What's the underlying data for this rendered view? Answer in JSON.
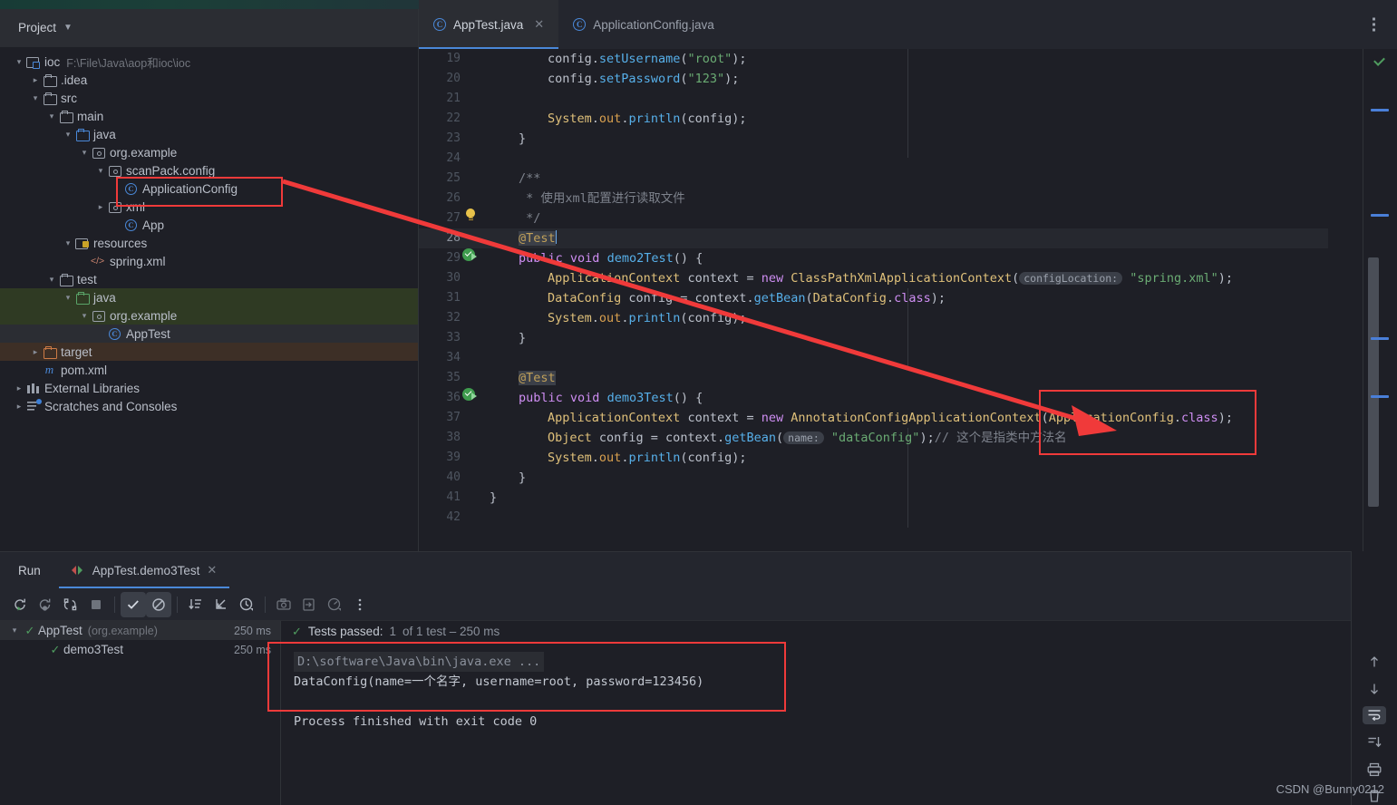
{
  "project_panel": {
    "title": "Project",
    "tree": [
      {
        "indent": 0,
        "arrow": "v",
        "icon": "module-icon",
        "label": "ioc",
        "sub": "F:\\File\\Java\\aop和ioc\\ioc"
      },
      {
        "indent": 1,
        "arrow": ">",
        "icon": "folder-icon",
        "label": ".idea",
        "sub": ""
      },
      {
        "indent": 1,
        "arrow": "v",
        "icon": "folder-icon",
        "label": "src",
        "sub": ""
      },
      {
        "indent": 2,
        "arrow": "v",
        "icon": "folder-icon",
        "label": "main",
        "sub": ""
      },
      {
        "indent": 3,
        "arrow": "v",
        "icon": "source-folder-icon",
        "label": "java",
        "sub": ""
      },
      {
        "indent": 4,
        "arrow": "v",
        "icon": "package-icon",
        "label": "org.example",
        "sub": ""
      },
      {
        "indent": 5,
        "arrow": "v",
        "icon": "package-icon",
        "label": "scanPack.config",
        "sub": ""
      },
      {
        "indent": 6,
        "arrow": "",
        "icon": "class-icon",
        "label": "ApplicationConfig",
        "sub": ""
      },
      {
        "indent": 5,
        "arrow": ">",
        "icon": "package-icon",
        "label": "xml",
        "sub": ""
      },
      {
        "indent": 6,
        "arrow": "",
        "icon": "class-icon",
        "label": "App",
        "sub": ""
      },
      {
        "indent": 3,
        "arrow": "v",
        "icon": "resources-folder-icon",
        "label": "resources",
        "sub": ""
      },
      {
        "indent": 4,
        "arrow": "",
        "icon": "xml-file-icon",
        "label": "spring.xml",
        "sub": ""
      },
      {
        "indent": 2,
        "arrow": "v",
        "icon": "folder-icon",
        "label": "test",
        "sub": ""
      },
      {
        "indent": 3,
        "arrow": "v",
        "icon": "test-source-folder-icon",
        "label": "java",
        "sub": ""
      },
      {
        "indent": 4,
        "arrow": "v",
        "icon": "package-icon",
        "label": "org.example",
        "sub": ""
      },
      {
        "indent": 5,
        "arrow": "",
        "icon": "class-icon",
        "label": "AppTest",
        "sub": ""
      },
      {
        "indent": 1,
        "arrow": ">",
        "icon": "excluded-folder-icon",
        "label": "target",
        "sub": ""
      },
      {
        "indent": 1,
        "arrow": "",
        "icon": "maven-file-icon",
        "label": "pom.xml",
        "sub": ""
      },
      {
        "indent": 0,
        "arrow": ">",
        "icon": "library-icon",
        "label": "External Libraries",
        "sub": ""
      },
      {
        "indent": 0,
        "arrow": ">",
        "icon": "scratches-icon",
        "label": "Scratches and Consoles",
        "sub": ""
      }
    ]
  },
  "editor": {
    "tabs": [
      {
        "label": "ApplicationConfig.java",
        "active": false,
        "closable": false
      },
      {
        "label": "AppTest.java",
        "active": true,
        "closable": true
      }
    ],
    "first_line": 19,
    "lines": [
      {
        "n": 19,
        "gutter": "",
        "indent": 2,
        "parts": [
          {
            "t": "config",
            "c": "var"
          },
          {
            "t": ".",
            "c": "pun"
          },
          {
            "t": "setUsername",
            "c": "mth"
          },
          {
            "t": "(",
            "c": "pun"
          },
          {
            "t": "\"root\"",
            "c": "str"
          },
          {
            "t": ");",
            "c": "pun"
          }
        ]
      },
      {
        "n": 20,
        "gutter": "",
        "indent": 2,
        "parts": [
          {
            "t": "config",
            "c": "var"
          },
          {
            "t": ".",
            "c": "pun"
          },
          {
            "t": "setPassword",
            "c": "mth"
          },
          {
            "t": "(",
            "c": "pun"
          },
          {
            "t": "\"123\"",
            "c": "str"
          },
          {
            "t": ");",
            "c": "pun"
          }
        ]
      },
      {
        "n": 21,
        "gutter": "",
        "indent": 0,
        "parts": []
      },
      {
        "n": 22,
        "gutter": "",
        "indent": 2,
        "parts": [
          {
            "t": "System",
            "c": "typ"
          },
          {
            "t": ".",
            "c": "pun"
          },
          {
            "t": "out",
            "c": "sout"
          },
          {
            "t": ".",
            "c": "pun"
          },
          {
            "t": "println",
            "c": "mth"
          },
          {
            "t": "(config);",
            "c": "pun"
          }
        ]
      },
      {
        "n": 23,
        "gutter": "",
        "indent": 1,
        "parts": [
          {
            "t": "}",
            "c": "pun"
          }
        ]
      },
      {
        "n": 24,
        "gutter": "",
        "indent": 0,
        "parts": []
      },
      {
        "n": 25,
        "gutter": "",
        "indent": 1,
        "parts": [
          {
            "t": "/**",
            "c": "cmt"
          }
        ]
      },
      {
        "n": 26,
        "gutter": "",
        "indent": 1,
        "parts": [
          {
            "t": " * 使用xml配置进行读取文件",
            "c": "cmt"
          }
        ]
      },
      {
        "n": 27,
        "gutter": "bulb-icon",
        "indent": 1,
        "parts": [
          {
            "t": " */",
            "c": "cmt"
          }
        ]
      },
      {
        "n": 28,
        "gutter": "",
        "indent": 1,
        "current": true,
        "parts": [
          {
            "t": "@Test",
            "c": "ann annhl"
          }
        ]
      },
      {
        "n": 29,
        "gutter": "run-test-icon",
        "indent": 1,
        "parts": [
          {
            "t": "public",
            "c": "kw"
          },
          {
            "t": " ",
            "c": "pun"
          },
          {
            "t": "void",
            "c": "kw"
          },
          {
            "t": " ",
            "c": "pun"
          },
          {
            "t": "demo2Test",
            "c": "mth"
          },
          {
            "t": "() {",
            "c": "pun"
          }
        ]
      },
      {
        "n": 30,
        "gutter": "",
        "indent": 2,
        "parts": [
          {
            "t": "ApplicationContext",
            "c": "typ"
          },
          {
            "t": " context = ",
            "c": "pun"
          },
          {
            "t": "new",
            "c": "kw"
          },
          {
            "t": " ",
            "c": "pun"
          },
          {
            "t": "ClassPathXmlApplicationContext",
            "c": "typ"
          },
          {
            "t": "(",
            "c": "pun"
          },
          {
            "t": "configLocation:",
            "c": "hint"
          },
          {
            "t": " ",
            "c": "pun"
          },
          {
            "t": "\"spring.xml\"",
            "c": "str"
          },
          {
            "t": ");",
            "c": "pun"
          }
        ]
      },
      {
        "n": 31,
        "gutter": "",
        "indent": 2,
        "parts": [
          {
            "t": "DataConfig",
            "c": "typ"
          },
          {
            "t": " config = context.",
            "c": "pun"
          },
          {
            "t": "getBean",
            "c": "mth"
          },
          {
            "t": "(",
            "c": "pun"
          },
          {
            "t": "DataConfig",
            "c": "typ"
          },
          {
            "t": ".",
            "c": "pun"
          },
          {
            "t": "class",
            "c": "kw"
          },
          {
            "t": ");",
            "c": "pun"
          }
        ]
      },
      {
        "n": 32,
        "gutter": "",
        "indent": 2,
        "parts": [
          {
            "t": "System",
            "c": "typ"
          },
          {
            "t": ".",
            "c": "pun"
          },
          {
            "t": "out",
            "c": "sout"
          },
          {
            "t": ".",
            "c": "pun"
          },
          {
            "t": "println",
            "c": "mth"
          },
          {
            "t": "(config);",
            "c": "pun"
          }
        ]
      },
      {
        "n": 33,
        "gutter": "",
        "indent": 1,
        "parts": [
          {
            "t": "}",
            "c": "pun"
          }
        ]
      },
      {
        "n": 34,
        "gutter": "",
        "indent": 0,
        "parts": []
      },
      {
        "n": 35,
        "gutter": "",
        "indent": 1,
        "parts": [
          {
            "t": "@Test",
            "c": "ann annhl"
          }
        ]
      },
      {
        "n": 36,
        "gutter": "run-test-icon",
        "indent": 1,
        "parts": [
          {
            "t": "public",
            "c": "kw"
          },
          {
            "t": " ",
            "c": "pun"
          },
          {
            "t": "void",
            "c": "kw"
          },
          {
            "t": " ",
            "c": "pun"
          },
          {
            "t": "demo3Test",
            "c": "mth"
          },
          {
            "t": "() {",
            "c": "pun"
          }
        ]
      },
      {
        "n": 37,
        "gutter": "",
        "indent": 2,
        "parts": [
          {
            "t": "ApplicationContext",
            "c": "typ"
          },
          {
            "t": " context = ",
            "c": "pun"
          },
          {
            "t": "new",
            "c": "kw"
          },
          {
            "t": " ",
            "c": "pun"
          },
          {
            "t": "AnnotationConfigApplicationContext",
            "c": "typ"
          },
          {
            "t": "(",
            "c": "pun"
          },
          {
            "t": "ApplicationConfig",
            "c": "typ"
          },
          {
            "t": ".",
            "c": "pun"
          },
          {
            "t": "class",
            "c": "kw"
          },
          {
            "t": ");",
            "c": "pun"
          }
        ]
      },
      {
        "n": 38,
        "gutter": "",
        "indent": 2,
        "parts": [
          {
            "t": "Object",
            "c": "typ"
          },
          {
            "t": " config = context.",
            "c": "pun"
          },
          {
            "t": "getBean",
            "c": "mth"
          },
          {
            "t": "(",
            "c": "pun"
          },
          {
            "t": "name:",
            "c": "hint"
          },
          {
            "t": " ",
            "c": "pun"
          },
          {
            "t": "\"dataConfig\"",
            "c": "str"
          },
          {
            "t": ");",
            "c": "pun"
          },
          {
            "t": "// 这个是指类中方法名",
            "c": "cmt"
          }
        ]
      },
      {
        "n": 39,
        "gutter": "",
        "indent": 2,
        "parts": [
          {
            "t": "System",
            "c": "typ"
          },
          {
            "t": ".",
            "c": "pun"
          },
          {
            "t": "out",
            "c": "sout"
          },
          {
            "t": ".",
            "c": "pun"
          },
          {
            "t": "println",
            "c": "mth"
          },
          {
            "t": "(config);",
            "c": "pun"
          }
        ]
      },
      {
        "n": 40,
        "gutter": "",
        "indent": 1,
        "parts": [
          {
            "t": "}",
            "c": "pun"
          }
        ]
      },
      {
        "n": 41,
        "gutter": "",
        "indent": 0,
        "parts": [
          {
            "t": "}",
            "c": "pun"
          }
        ]
      },
      {
        "n": 42,
        "gutter": "",
        "indent": 0,
        "parts": []
      }
    ]
  },
  "run_panel": {
    "title": "Run",
    "tab_label": "AppTest.demo3Test",
    "toolbar": [
      {
        "name": "rerun-button",
        "pressed": false
      },
      {
        "name": "rerun-failed-tests-button",
        "pressed": false
      },
      {
        "name": "toggle-auto-test-button",
        "pressed": false
      },
      {
        "name": "stop-button",
        "pressed": false
      },
      {
        "name": "show-passed-button",
        "pressed": true
      },
      {
        "name": "show-ignored-button",
        "pressed": true
      },
      {
        "name": "sort-by-duration-button",
        "pressed": false
      },
      {
        "name": "expand-collapse-button",
        "pressed": false
      },
      {
        "name": "history-button",
        "pressed": false
      },
      {
        "name": "export-screenshot-button",
        "pressed": false
      },
      {
        "name": "import-tests-button",
        "pressed": false
      },
      {
        "name": "profiler-button",
        "pressed": false
      },
      {
        "name": "more-options-button",
        "pressed": false
      }
    ],
    "tests": [
      {
        "chevron": "v",
        "label": "AppTest",
        "pkg": "(org.example)",
        "time": "250 ms",
        "selected": true,
        "indent": 0
      },
      {
        "chevron": "",
        "label": "demo3Test",
        "pkg": "",
        "time": "250 ms",
        "selected": false,
        "indent": 1
      }
    ],
    "status": {
      "prefix": "Tests passed:",
      "count": "1",
      "detail": "of 1 test – 250 ms"
    },
    "console": {
      "command": "D:\\software\\Java\\bin\\java.exe ...",
      "output": "DataConfig(name=一个名字, username=root, password=123456)",
      "exit": "Process finished with exit code 0"
    },
    "rail": [
      {
        "name": "up-arrow-icon",
        "pressed": false
      },
      {
        "name": "down-arrow-icon",
        "pressed": false
      },
      {
        "name": "soft-wrap-icon",
        "pressed": true
      },
      {
        "name": "scroll-to-end-icon",
        "pressed": false
      },
      {
        "name": "print-icon",
        "pressed": false
      },
      {
        "name": "trash-icon",
        "pressed": false
      }
    ]
  },
  "watermark": "CSDN @Bunny0212",
  "colors": {
    "accent": "#4a88d8",
    "annotation_red": "#f03a3a",
    "test_green": "#4f9c5f"
  }
}
